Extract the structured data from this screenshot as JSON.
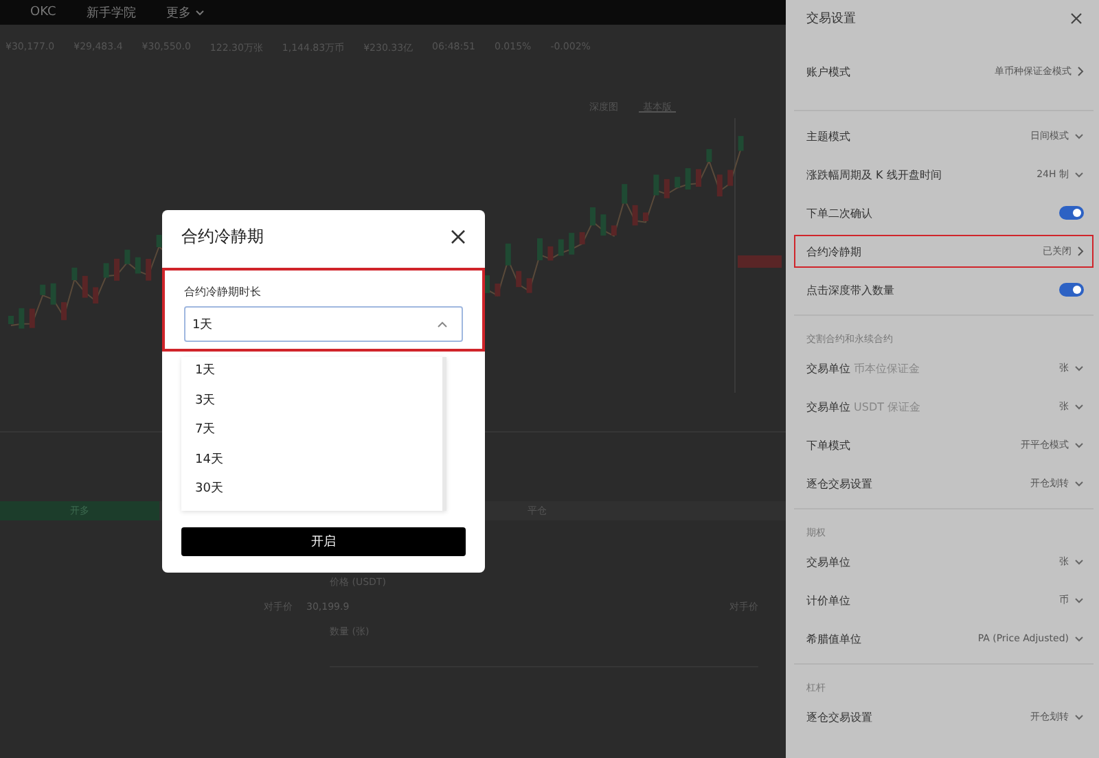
{
  "top_nav": {
    "items": [
      {
        "label": "OKC",
        "dropdown": false
      },
      {
        "label": "新手学院",
        "dropdown": false
      },
      {
        "label": "更多",
        "dropdown": true
      }
    ]
  },
  "ticker_stats": [
    {
      "value": "¥30,177.0"
    },
    {
      "value": "¥29,483.4"
    },
    {
      "value": "¥30,550.0"
    },
    {
      "value": "122.30万张"
    },
    {
      "value": "1,144.83万币"
    },
    {
      "value": "¥230.33亿"
    },
    {
      "value": "06:48:51"
    },
    {
      "value": "0.015%"
    },
    {
      "value": "-0.002%"
    }
  ],
  "chart_toolbar": {
    "tabs": [
      {
        "label": "深度图",
        "selected": false
      },
      {
        "label": "基本版",
        "selected": true
      }
    ]
  },
  "order_form": {
    "tabs": [
      {
        "label": "开多",
        "selected": true
      },
      {
        "label": "平仓",
        "selected": false
      }
    ],
    "price_label": "价格 (USDT)",
    "price": "30,199.9",
    "quantity_label": "数量 (张)",
    "side_labels": [
      "对手价",
      "对手价"
    ]
  },
  "trade_settings": {
    "title": "交易设置",
    "sections": [
      {
        "items": [
          {
            "kind": "nav",
            "label": "账户模式",
            "value": "单币种保证金模式",
            "highlighted": false
          }
        ]
      },
      {
        "items": [
          {
            "kind": "select",
            "label": "主题模式",
            "value": "日间模式",
            "highlighted": false
          },
          {
            "kind": "select",
            "label": "涨跌幅周期及 K 线开盘时间",
            "value": "24H 制",
            "highlighted": false
          },
          {
            "kind": "toggle",
            "label": "下单二次确认",
            "on": true,
            "highlighted": false
          },
          {
            "kind": "nav",
            "label": "合约冷静期",
            "value": "已关闭",
            "highlighted": true
          },
          {
            "kind": "toggle",
            "label": "点击深度带入数量",
            "on": true,
            "highlighted": false
          }
        ]
      },
      {
        "header": "交割合约和永续合约",
        "items": [
          {
            "kind": "select",
            "label": "交易单位",
            "note": "币本位保证金",
            "value": "张",
            "highlighted": false
          },
          {
            "kind": "select",
            "label": "交易单位",
            "note": "USDT 保证金",
            "value": "张",
            "highlighted": false
          },
          {
            "kind": "select",
            "label": "下单模式",
            "value": "开平仓模式",
            "highlighted": false
          },
          {
            "kind": "select",
            "label": "逐仓交易设置",
            "value": "开仓划转",
            "highlighted": false
          }
        ]
      },
      {
        "header": "期权",
        "items": [
          {
            "kind": "select",
            "label": "交易单位",
            "value": "张",
            "highlighted": false
          },
          {
            "kind": "select",
            "label": "计价单位",
            "value": "币",
            "highlighted": false
          },
          {
            "kind": "select",
            "label": "希腊值单位",
            "value": "PA (Price Adjusted)",
            "highlighted": false
          }
        ]
      },
      {
        "header": "杠杆",
        "items": [
          {
            "kind": "select",
            "label": "逐仓交易设置",
            "value": "开仓划转",
            "highlighted": false
          }
        ]
      }
    ]
  },
  "dialog": {
    "title": "合约冷静期",
    "field_label": "合约冷静期时长",
    "value": "1天",
    "expanded": true,
    "highlighted": true,
    "options": [
      {
        "label": "1天"
      },
      {
        "label": "3天"
      },
      {
        "label": "7天"
      },
      {
        "label": "14天"
      },
      {
        "label": "30天"
      }
    ],
    "button": "开启"
  }
}
